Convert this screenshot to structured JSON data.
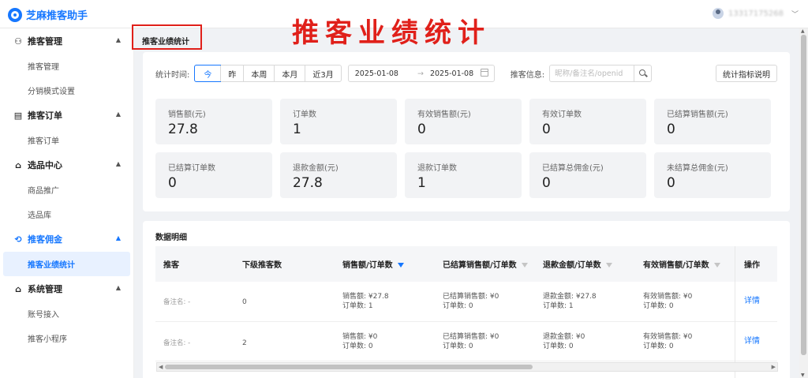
{
  "app": {
    "title": "芝麻推客助手",
    "brand_color": "#1677ff",
    "user": "13317175268"
  },
  "sidebar": {
    "groups": [
      {
        "label": "推客管理",
        "icon": "users-icon",
        "items": [
          "推客管理",
          "分销模式设置"
        ]
      },
      {
        "label": "推客订单",
        "icon": "order-icon",
        "items": [
          "推客订单"
        ]
      },
      {
        "label": "选品中心",
        "icon": "shop-icon",
        "items": [
          "商品推广",
          "选品库"
        ]
      },
      {
        "label": "推客佣金",
        "icon": "commission-icon",
        "items": [
          "推客业绩统计"
        ],
        "active": true
      },
      {
        "label": "系统管理",
        "icon": "home-icon",
        "items": [
          "账号接入",
          "推客小程序"
        ]
      }
    ],
    "active_item": "推客业绩统计"
  },
  "page": {
    "title": "推客业绩统计",
    "stamp_text": "推客业绩统计",
    "stamp_color": "#e0201a"
  },
  "filters": {
    "time_label": "统计时间:",
    "periods": [
      "今",
      "昨",
      "本周",
      "本月",
      "近3月"
    ],
    "active_period": "今",
    "date_start": "2025-01-08",
    "date_end": "2025-01-08",
    "date_separator": "→",
    "info_label": "推客信息:",
    "search_placeholder": "昵称/备注名/openid",
    "explain_button": "统计指标说明"
  },
  "stats": [
    {
      "label": "销售额(元)",
      "value": "27.8"
    },
    {
      "label": "订单数",
      "value": "1"
    },
    {
      "label": "有效销售额(元)",
      "value": "0"
    },
    {
      "label": "有效订单数",
      "value": "0"
    },
    {
      "label": "已结算销售额(元)",
      "value": "0"
    },
    {
      "label": "已结算订单数",
      "value": "0"
    },
    {
      "label": "退款金额(元)",
      "value": "27.8"
    },
    {
      "label": "退款订单数",
      "value": "1"
    },
    {
      "label": "已结算总佣金(元)",
      "value": "0"
    },
    {
      "label": "未结算总佣金(元)",
      "value": "0"
    }
  ],
  "table": {
    "title": "数据明细",
    "columns": [
      "推客",
      "下级推客数",
      "销售额/订单数",
      "已结算销售额/订单数",
      "退款金额/订单数",
      "有效销售额/订单数",
      "操作"
    ],
    "rows": [
      {
        "tuike": "备注名: -",
        "sub_count": "0",
        "sales": [
          "销售额: ¥27.8",
          "订单数: 1"
        ],
        "settled": [
          "已结算销售额: ¥0",
          "订单数: 0"
        ],
        "refund": [
          "退款金额: ¥27.8",
          "订单数: 1"
        ],
        "valid": [
          "有效销售额: ¥0",
          "订单数: 0"
        ],
        "action": "详情"
      },
      {
        "tuike": "备注名: -",
        "sub_count": "2",
        "sales": [
          "销售额: ¥0",
          "订单数: 0"
        ],
        "settled": [
          "已结算销售额: ¥0",
          "订单数: 0"
        ],
        "refund": [
          "退款金额: ¥0",
          "订单数: 0"
        ],
        "valid": [
          "有效销售额: ¥0",
          "订单数: 0"
        ],
        "action": "详情"
      }
    ]
  }
}
